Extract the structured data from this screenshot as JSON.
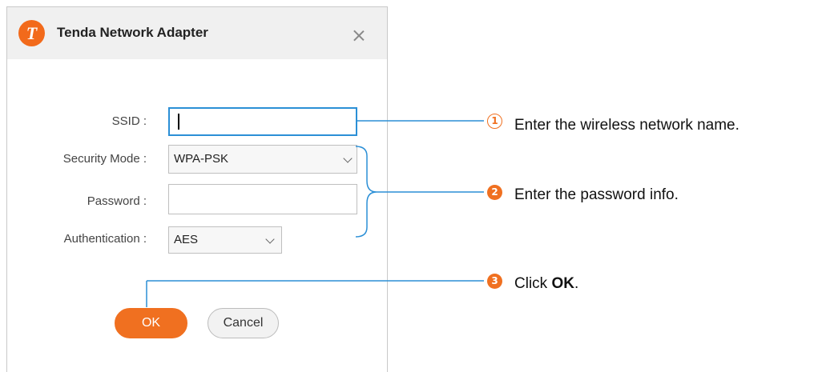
{
  "window": {
    "logo_letter": "T",
    "title": "Tenda Network Adapter"
  },
  "form": {
    "ssid_label": "SSID :",
    "ssid_value": "",
    "security_label": "Security Mode :",
    "security_value": "WPA-PSK",
    "password_label": "Password :",
    "password_value": "",
    "auth_label": "Authentication :",
    "auth_value": "AES"
  },
  "buttons": {
    "ok": "OK",
    "cancel": "Cancel"
  },
  "annotations": [
    {
      "number": "1",
      "text": "Enter the wireless network name."
    },
    {
      "number": "2",
      "text": "Enter the password info."
    },
    {
      "number": "3",
      "text_prefix": "Click ",
      "text_bold": "OK",
      "text_suffix": "."
    }
  ],
  "colors": {
    "accent_orange": "#f07020",
    "callout_blue": "#2b8fd6"
  },
  "icons": [
    "tenda-logo-icon",
    "close-icon",
    "chevron-down-icon"
  ]
}
